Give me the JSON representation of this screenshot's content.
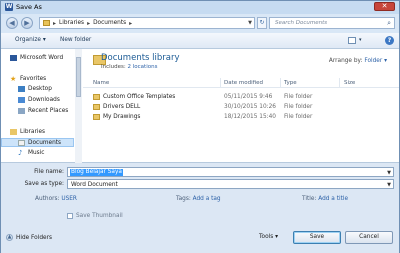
{
  "window": {
    "title": "Save As",
    "app_icon": "W"
  },
  "nav": {
    "breadcrumb": [
      "Libraries",
      "Documents"
    ],
    "search_placeholder": "Search Documents"
  },
  "toolbar": {
    "organize": "Organize ▾",
    "new_folder": "New folder"
  },
  "sidebar": {
    "items": [
      {
        "label": "Microsoft Word",
        "icon": "word-icon"
      },
      {
        "label": "Favorites",
        "icon": "star-icon"
      },
      {
        "label": "Desktop",
        "icon": "desktop-icon"
      },
      {
        "label": "Downloads",
        "icon": "downloads-icon"
      },
      {
        "label": "Recent Places",
        "icon": "recent-icon"
      },
      {
        "label": "Libraries",
        "icon": "libraries-icon"
      },
      {
        "label": "Documents",
        "icon": "documents-icon",
        "selected": true
      },
      {
        "label": "Music",
        "icon": "music-icon"
      }
    ]
  },
  "library": {
    "title": "Documents library",
    "includes_prefix": "Includes:",
    "includes_link": "2 locations",
    "arrange_label": "Arrange by:",
    "arrange_value": "Folder ▾"
  },
  "columns": [
    "Name",
    "Date modified",
    "Type",
    "Size"
  ],
  "files": [
    {
      "name": "Custom Office Templates",
      "date": "05/11/2015 9:46",
      "type": "File folder",
      "size": ""
    },
    {
      "name": "Drivers DELL",
      "date": "30/10/2015 10:26",
      "type": "File folder",
      "size": ""
    },
    {
      "name": "My Drawings",
      "date": "18/12/2015 15:40",
      "type": "File folder",
      "size": ""
    }
  ],
  "form": {
    "file_name_label": "File name:",
    "file_name_value": "Blog Belajar Saya",
    "save_type_label": "Save as type:",
    "save_type_value": "Word Document",
    "authors_label": "Authors:",
    "authors_value": "USER",
    "tags_label": "Tags:",
    "tags_value": "Add a tag",
    "title_label": "Title:",
    "title_value": "Add a title",
    "thumbnail_label": "Save Thumbnail"
  },
  "footer": {
    "hide_folders": "Hide Folders",
    "tools": "Tools ▾",
    "save": "Save",
    "cancel": "Cancel"
  }
}
